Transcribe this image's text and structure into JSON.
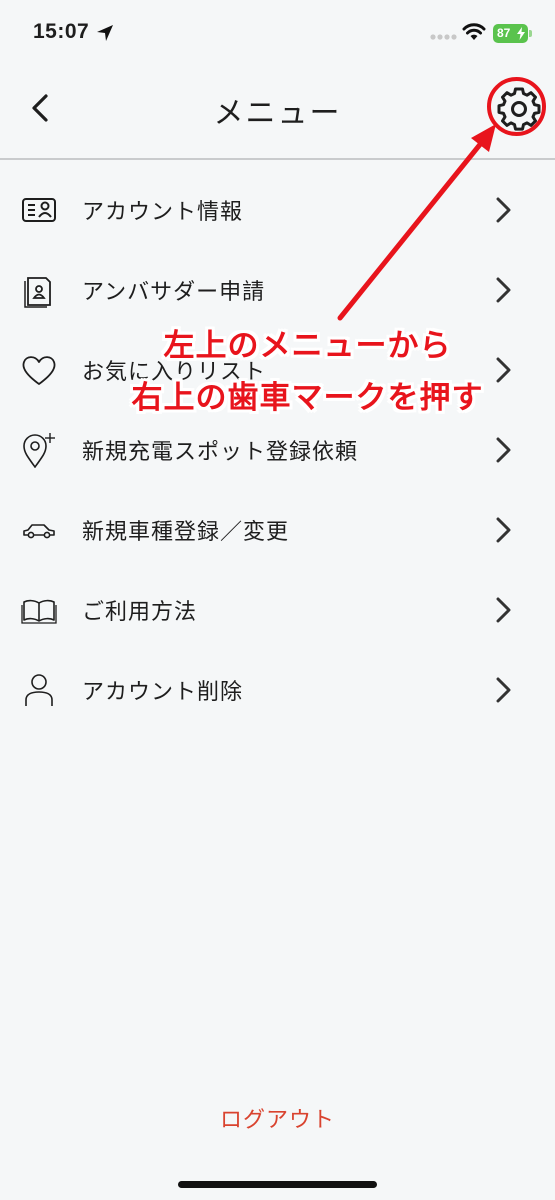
{
  "status_bar": {
    "time": "15:07",
    "battery_level": "87",
    "icons": [
      "location-arrow-icon",
      "signal-icon",
      "wifi-icon",
      "battery-icon"
    ]
  },
  "header": {
    "title": "メニュー",
    "back_icon": "chevron-left-icon",
    "settings_icon": "gear-icon"
  },
  "menu": {
    "items": [
      {
        "label": "アカウント情報",
        "icon": "id-card-icon"
      },
      {
        "label": "アンバサダー申請",
        "icon": "document-person-icon"
      },
      {
        "label": "お気に入りリスト",
        "icon": "heart-icon"
      },
      {
        "label": "新規充電スポット登録依頼",
        "icon": "location-pin-plus-icon"
      },
      {
        "label": "新規車種登録／変更",
        "icon": "car-icon"
      },
      {
        "label": "ご利用方法",
        "icon": "book-icon"
      },
      {
        "label": "アカウント削除",
        "icon": "person-icon"
      }
    ]
  },
  "annotation": {
    "line1": "左上のメニューから",
    "line2": "右上の歯車マークを押す",
    "color": "#e8141c"
  },
  "footer": {
    "logout_label": "ログアウト",
    "logout_color": "#d9432f"
  }
}
